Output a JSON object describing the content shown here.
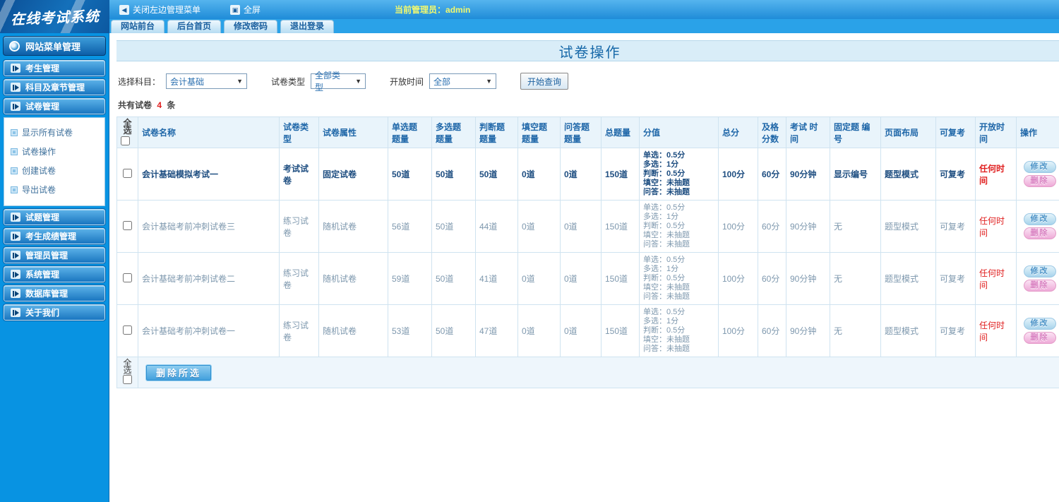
{
  "topbar": {
    "logo": "在线考试系统",
    "close_menu_label": "关闭左边管理菜单",
    "fullscreen_label": "全屏",
    "admin_label": "当前管理员：admin",
    "tabs": [
      "网站前台",
      "后台首页",
      "修改密码",
      "退出登录"
    ]
  },
  "icons": {
    "close_menu": "◀",
    "fullscreen": "▣"
  },
  "sidebar": {
    "header": "网站菜单管理",
    "groups_top": [
      "考生管理",
      "科目及章节管理",
      "试卷管理"
    ],
    "submenu": [
      "显示所有试卷",
      "试卷操作",
      "创建试卷",
      "导出试卷"
    ],
    "groups_bottom": [
      "试题管理",
      "考生成绩管理",
      "管理员管理",
      "系统管理",
      "数据库管理",
      "关于我们"
    ]
  },
  "main": {
    "title": "试卷操作",
    "filters": {
      "subject_label": "选择科目：",
      "subject_value": "会计基础",
      "type_label": "试卷类型",
      "type_value": "全部类型",
      "time_label": "开放时间",
      "time_value": "全部",
      "search_button": "开始查询",
      "dropdown_arrow": "▼"
    },
    "count_prefix": "共有试卷",
    "count_number": "4",
    "count_suffix": "条",
    "table": {
      "headers": [
        "全选",
        "试卷名称",
        "试卷类型",
        "试卷属性",
        "单选题 题量",
        "多选题 题量",
        "判断题 题量",
        "填空题 题量",
        "问答题 题量",
        "总题量",
        "分值",
        "总分",
        "及格 分数",
        "考试 时间",
        "固定题 编号",
        "页面布局",
        "可复考",
        "开放时间",
        "操作"
      ],
      "actions": {
        "edit": "修改",
        "delete": "删除"
      },
      "footer": {
        "select_all": "全选",
        "delete_selected": "删除所选"
      },
      "rows": [
        {
          "name": "会计基础模拟考试一",
          "type": "考试试卷",
          "attr": "固定试卷",
          "single": "50道",
          "multi": "50道",
          "judge": "50道",
          "blank": "0道",
          "qa": "0道",
          "total": "150道",
          "score_lines": [
            "单选：0.5分",
            "多选：1分",
            "判断：0.5分",
            "填空：未抽题",
            "问答：未抽题"
          ],
          "total_score": "100分",
          "pass_score": "60分",
          "exam_time": "90分钟",
          "fixed_no": "显示编号",
          "layout": "题型模式",
          "retake": "可复考",
          "open_time": "任何时间",
          "emphasis": true
        },
        {
          "name": "会计基础考前冲刺试卷三",
          "type": "练习试卷",
          "attr": "随机试卷",
          "single": "56道",
          "multi": "50道",
          "judge": "44道",
          "blank": "0道",
          "qa": "0道",
          "total": "150道",
          "score_lines": [
            "单选：0.5分",
            "多选：1分",
            "判断：0.5分",
            "填空：未抽题",
            "问答：未抽题"
          ],
          "total_score": "100分",
          "pass_score": "60分",
          "exam_time": "90分钟",
          "fixed_no": "无",
          "layout": "题型模式",
          "retake": "可复考",
          "open_time": "任何时间",
          "emphasis": false
        },
        {
          "name": "会计基础考前冲刺试卷二",
          "type": "练习试卷",
          "attr": "随机试卷",
          "single": "59道",
          "multi": "50道",
          "judge": "41道",
          "blank": "0道",
          "qa": "0道",
          "total": "150道",
          "score_lines": [
            "单选：0.5分",
            "多选：1分",
            "判断：0.5分",
            "填空：未抽题",
            "问答：未抽题"
          ],
          "total_score": "100分",
          "pass_score": "60分",
          "exam_time": "90分钟",
          "fixed_no": "无",
          "layout": "题型模式",
          "retake": "可复考",
          "open_time": "任何时间",
          "emphasis": false
        },
        {
          "name": "会计基础考前冲刺试卷一",
          "type": "练习试卷",
          "attr": "随机试卷",
          "single": "53道",
          "multi": "50道",
          "judge": "47道",
          "blank": "0道",
          "qa": "0道",
          "total": "150道",
          "score_lines": [
            "单选：0.5分",
            "多选：1分",
            "判断：0.5分",
            "填空：未抽题",
            "问答：未抽题"
          ],
          "total_score": "100分",
          "pass_score": "60分",
          "exam_time": "90分钟",
          "fixed_no": "无",
          "layout": "题型模式",
          "retake": "可复考",
          "open_time": "任何时间",
          "emphasis": false
        }
      ]
    }
  }
}
